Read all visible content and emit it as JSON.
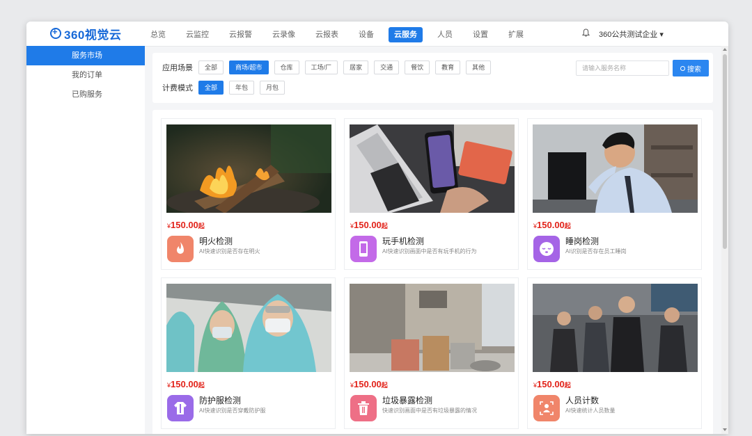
{
  "brand": {
    "name": "360视觉云"
  },
  "nav": [
    "总览",
    "云监控",
    "云报警",
    "云录像",
    "云报表",
    "设备",
    "云服务",
    "人员",
    "设置",
    "扩展"
  ],
  "nav_active": 6,
  "account": {
    "label": "360公共测试企业 ▾"
  },
  "sidebar": {
    "items": [
      {
        "label": "服务市场",
        "active": true
      },
      {
        "label": "我的订单"
      },
      {
        "label": "已购服务"
      }
    ]
  },
  "filter": {
    "scene_label": "应用场景",
    "scenes": [
      "全部",
      "商场/超市",
      "仓库",
      "工场/厂",
      "居家",
      "交通",
      "餐饮",
      "教育",
      "其他"
    ],
    "scene_active": 1,
    "billing_label": "计费模式",
    "billing": [
      "全部",
      "年包",
      "月包"
    ],
    "billing_active": 0,
    "search_placeholder": "请输入服务名称",
    "search_button": "搜索"
  },
  "cards": [
    {
      "price": "150.00",
      "currency": "¥",
      "suffix": "起",
      "title": "明火检测",
      "desc": "AI快速识别是否存在明火",
      "icon": "flame-icon",
      "color": "#f0856a"
    },
    {
      "price": "150.00",
      "currency": "¥",
      "suffix": "起",
      "title": "玩手机检测",
      "desc": "AI快速识别画面中是否有玩手机的行为",
      "icon": "phone-icon",
      "color": "#c36ae8"
    },
    {
      "price": "150.00",
      "currency": "¥",
      "suffix": "起",
      "title": "睡岗检测",
      "desc": "AI识别是否存在员工睡岗",
      "icon": "sleep-face-icon",
      "color": "#a564e6"
    },
    {
      "price": "150.00",
      "currency": "¥",
      "suffix": "起",
      "title": "防护服检测",
      "desc": "AI快速识别是否穿戴防护服",
      "icon": "protective-suit-icon",
      "color": "#9a6be8"
    },
    {
      "price": "150.00",
      "currency": "¥",
      "suffix": "起",
      "title": "垃圾暴露检测",
      "desc": "快速识别画面中是否有垃圾暴露的情况",
      "icon": "trash-icon",
      "color": "#ee6f86"
    },
    {
      "price": "150.00",
      "currency": "¥",
      "suffix": "起",
      "title": "人员计数",
      "desc": "AI快速统计人员数量",
      "icon": "person-count-icon",
      "color": "#f0856a"
    }
  ]
}
